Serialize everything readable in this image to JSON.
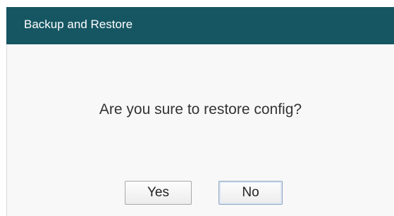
{
  "dialog": {
    "title": "Backup and Restore",
    "message": "Are you sure to restore config?",
    "buttons": {
      "yes_label": "Yes",
      "no_label": "No"
    }
  },
  "colors": {
    "title_bar": "#165663",
    "title_text": "#ffffff",
    "body_background": "#f8f8f8"
  }
}
